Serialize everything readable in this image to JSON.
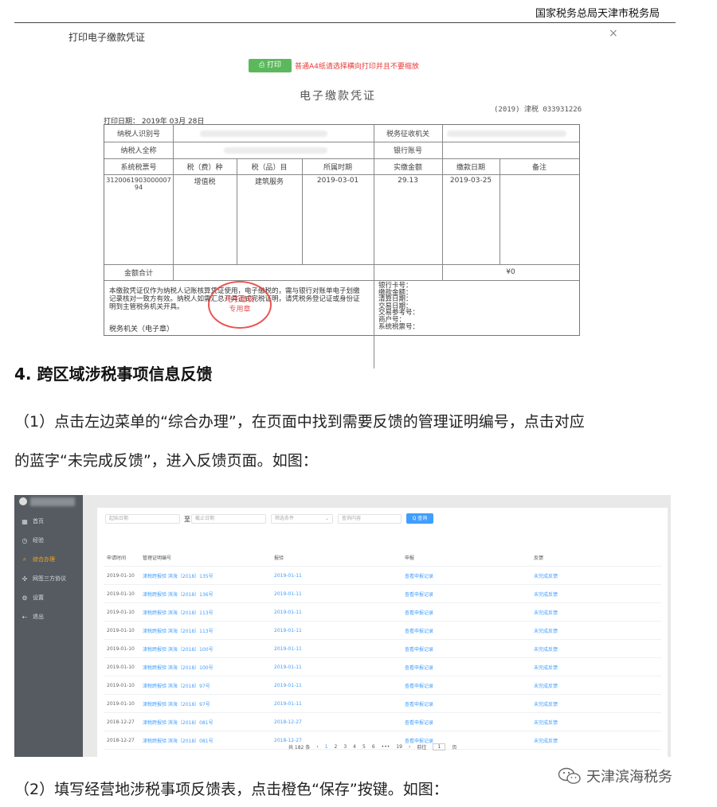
{
  "header": {
    "agency": "国家税务总局天津市税务局"
  },
  "dialog": {
    "title": "打印电子缴款凭证",
    "close": "×",
    "print_button": "⎙ 打印",
    "print_note": "普通A4纸请选择横向打印并且不要缩放"
  },
  "voucher": {
    "title": "电子缴款凭证",
    "serial": "(2019) 津税 033931226",
    "print_date": "打印日期：  2019年  03月  28日",
    "labels": {
      "taxpayer_id": "纳税人识别号",
      "tax_office": "税务征收机关",
      "taxpayer_name": "纳税人全称",
      "bank_account": "银行账号",
      "ticket_no": "系统税票号",
      "tax_type": "税（费）种",
      "tax_item": "税（品）目",
      "period": "所属时期",
      "amount": "实缴金额",
      "pay_date": "缴款日期",
      "remark": "备注",
      "total": "金额合计"
    },
    "row": {
      "ticket_no": "3120061903000007 94",
      "tax_type": "增值税",
      "tax_item": "建筑服务",
      "period": "2019-03-01",
      "amount": "29.13",
      "pay_date": "2019-03-25"
    },
    "total_value": "¥0",
    "note": "本缴款凭证仅作为纳税人记账核算凭证使用，电子缴税的，需与银行对账单电子划缴记录核对一致方有效。纳税人如需汇总开具正式完税证明，请凭税务登记证或身份证明到主管税务机关开具。",
    "bank_fields": [
      "银行卡号：",
      "缴款金额：",
      "清算日期：",
      "交易日期：",
      "交易参考号：",
      "商户号：",
      "系统税票号："
    ],
    "tax_org": "税务机关（电子章）",
    "seal": [
      "电子缴税",
      "专用章"
    ]
  },
  "article": {
    "heading": "4. 跨区域涉税事项信息反馈",
    "para1_line1": "（1）点击左边菜单的“综合办理”，在页面中找到需要反馈的管理证明编号，点击对应",
    "para1_line2": "的蓝字“未完成反馈”，进入反馈页面。如图：",
    "para2": "（2）填写经营地涉税事项反馈表，点击橙色“保存”按键。如图："
  },
  "app": {
    "sidebar": [
      {
        "icon": "grid-icon",
        "glyph": "▦",
        "label": "首页"
      },
      {
        "icon": "clock-icon",
        "glyph": "◷",
        "label": "经验"
      },
      {
        "icon": "search-icon",
        "glyph": "⌕",
        "label": "综合办理"
      },
      {
        "icon": "move-icon",
        "glyph": "✣",
        "label": "网签三方协议"
      },
      {
        "icon": "gear-icon",
        "glyph": "⚙",
        "label": "设置"
      },
      {
        "icon": "logout-icon",
        "glyph": "⇠",
        "label": "退出"
      }
    ],
    "active_index": 2,
    "filters": {
      "start_date": "起始日期",
      "separator": "至",
      "end_date": "截止日期",
      "status": "筛选条件",
      "keyword": "查询内容",
      "query_button": "Q 查询"
    },
    "columns": [
      "申请时间",
      "管理证明编号",
      "报验",
      "申报",
      "反馈"
    ],
    "rows": [
      [
        "2019-01-10",
        "津税跨报验 滨海〔2018〕135号",
        "2019-01-11",
        "查看申报记录",
        "未完成反馈"
      ],
      [
        "2019-01-10",
        "津税跨报验 滨海〔2018〕136号",
        "2019-01-11",
        "查看申报记录",
        "未完成反馈"
      ],
      [
        "2019-01-10",
        "津税跨报验 滨海〔2018〕113号",
        "2019-01-11",
        "查看申报记录",
        "未完成反馈"
      ],
      [
        "2019-01-10",
        "津税跨报验 滨海〔2018〕113号",
        "2019-01-11",
        "查看申报记录",
        "未完成反馈"
      ],
      [
        "2019-01-10",
        "津税跨报验 滨海〔2018〕100号",
        "2019-01-11",
        "查看申报记录",
        "未完成反馈"
      ],
      [
        "2019-01-10",
        "津税跨报验 滨海〔2018〕100号",
        "2019-01-11",
        "查看申报记录",
        "未完成反馈"
      ],
      [
        "2019-01-10",
        "津税跨报验 滨海〔2018〕97号",
        "2019-01-11",
        "查看申报记录",
        "未完成反馈"
      ],
      [
        "2019-01-10",
        "津税跨报验 滨海〔2018〕97号",
        "2019-01-11",
        "查看申报记录",
        "未完成反馈"
      ],
      [
        "2018-12-27",
        "津税跨报验 滨海〔2018〕081号",
        "2018-12-27",
        "查看申报记录",
        "未完成反馈"
      ],
      [
        "2018-12-27",
        "津税跨报验 滨海〔2018〕081号",
        "2018-12-27",
        "查看申报记录",
        "未完成反馈"
      ]
    ],
    "pager": {
      "total": "共 182 条",
      "prev": "‹",
      "pages": [
        "1",
        "2",
        "3",
        "4",
        "5",
        "6",
        "•••",
        "19"
      ],
      "current": "1",
      "next": "›",
      "goto": "前往",
      "goto_value": "1",
      "page_suffix": "页"
    }
  },
  "watermark": {
    "text": "天津滨海税务"
  },
  "colors": {
    "accent_blue": "#409eff",
    "print_green": "#5cb85c",
    "warning_red": "#e53935",
    "active_orange": "#f5a623",
    "sidebar_bg": "#555b61"
  }
}
